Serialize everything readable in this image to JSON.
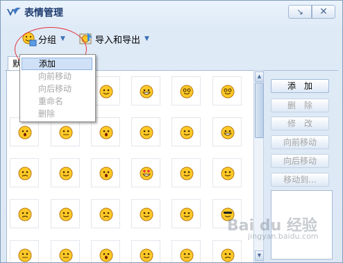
{
  "window": {
    "title": "表情管理",
    "min_symbol": "↘",
    "close_symbol": "✕"
  },
  "toolbar": {
    "group_label": "分组",
    "import_export_label": "导入和导出",
    "caret": "▼"
  },
  "tab": {
    "label": "默"
  },
  "menu": {
    "items": [
      {
        "label": "添加",
        "state": "highlight"
      },
      {
        "label": "向前移动",
        "state": "disabled"
      },
      {
        "label": "向后移动",
        "state": "disabled"
      },
      {
        "label": "重命名",
        "state": "disabled"
      },
      {
        "label": "删除",
        "state": "disabled"
      }
    ]
  },
  "side_buttons": [
    {
      "label": "添　加",
      "enabled": true
    },
    {
      "label": "删　除",
      "enabled": false
    },
    {
      "label": "修　改",
      "enabled": false
    },
    {
      "label": "向前移动",
      "enabled": false
    },
    {
      "label": "向后移动",
      "enabled": false
    },
    {
      "label": "移动到...",
      "enabled": false
    }
  ],
  "watermark": {
    "main": "Bai du 经验",
    "sub": "jingyan.baidu.com"
  },
  "colors": {
    "face": "#ffc928",
    "face_edge": "#b5760a",
    "accent_ellipse": "#e2343a"
  },
  "emoticons": [
    [
      "smile-grin",
      "tongue",
      "big-grin",
      "dizzy",
      "swirl-eyes"
    ],
    [
      "surprised",
      "straight-face",
      "shocked",
      "crazy",
      "awkward",
      "laughing"
    ],
    [
      "sad",
      "smirk",
      "wide-eyes",
      "heart-eyes",
      "sweat",
      "shy"
    ],
    [
      "confused",
      "sigh",
      "crying",
      "pout",
      "cool-sweat",
      "sunglasses"
    ],
    [
      "sleepy",
      "tired",
      "scared",
      "heart",
      "bored",
      "grumpy"
    ]
  ]
}
